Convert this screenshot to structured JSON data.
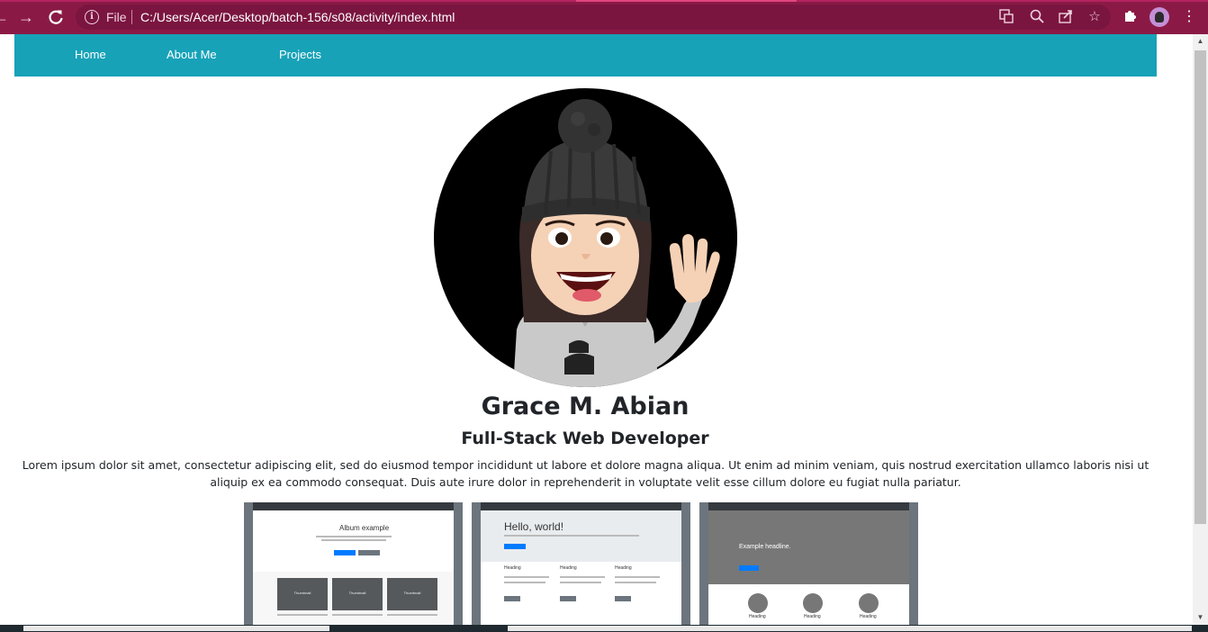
{
  "browser": {
    "file_label": "File",
    "url": "C:/Users/Acer/Desktop/batch-156/s08/activity/index.html",
    "icons": [
      "back-icon",
      "forward-icon",
      "reload-icon",
      "info-icon",
      "translate-icon",
      "zoom-icon",
      "share-icon",
      "star-icon",
      "extensions-icon",
      "menu-icon"
    ],
    "colors": {
      "frame": "#8a1a45",
      "omnibox": "#7a1540"
    }
  },
  "navbar": {
    "color": "#17a2b8",
    "links": [
      "Home",
      "About Me",
      "Projects"
    ]
  },
  "profile": {
    "name": "Grace M. Abian",
    "title": "Full-Stack Web Developer",
    "bio": "Lorem ipsum dolor sit amet, consectetur adipiscing elit, sed do eiusmod tempor incididunt ut labore et dolore magna aliqua. Ut enim ad minim veniam, quis nostrud exercitation ullamco laboris nisi ut aliquip ex ea commodo consequat. Duis aute irure dolor in reprehenderit in voluptate velit esse cillum dolore eu fugiat nulla pariatur."
  },
  "projects": [
    {
      "heading": "Album example",
      "cards": [
        "Thumbnail",
        "Thumbnail",
        "Thumbnail"
      ]
    },
    {
      "heading": "Hello, world!",
      "columns": [
        "Heading",
        "Heading",
        "Heading"
      ]
    },
    {
      "heading": "Example headline.",
      "columns": [
        "Heading",
        "Heading",
        "Heading"
      ]
    }
  ]
}
